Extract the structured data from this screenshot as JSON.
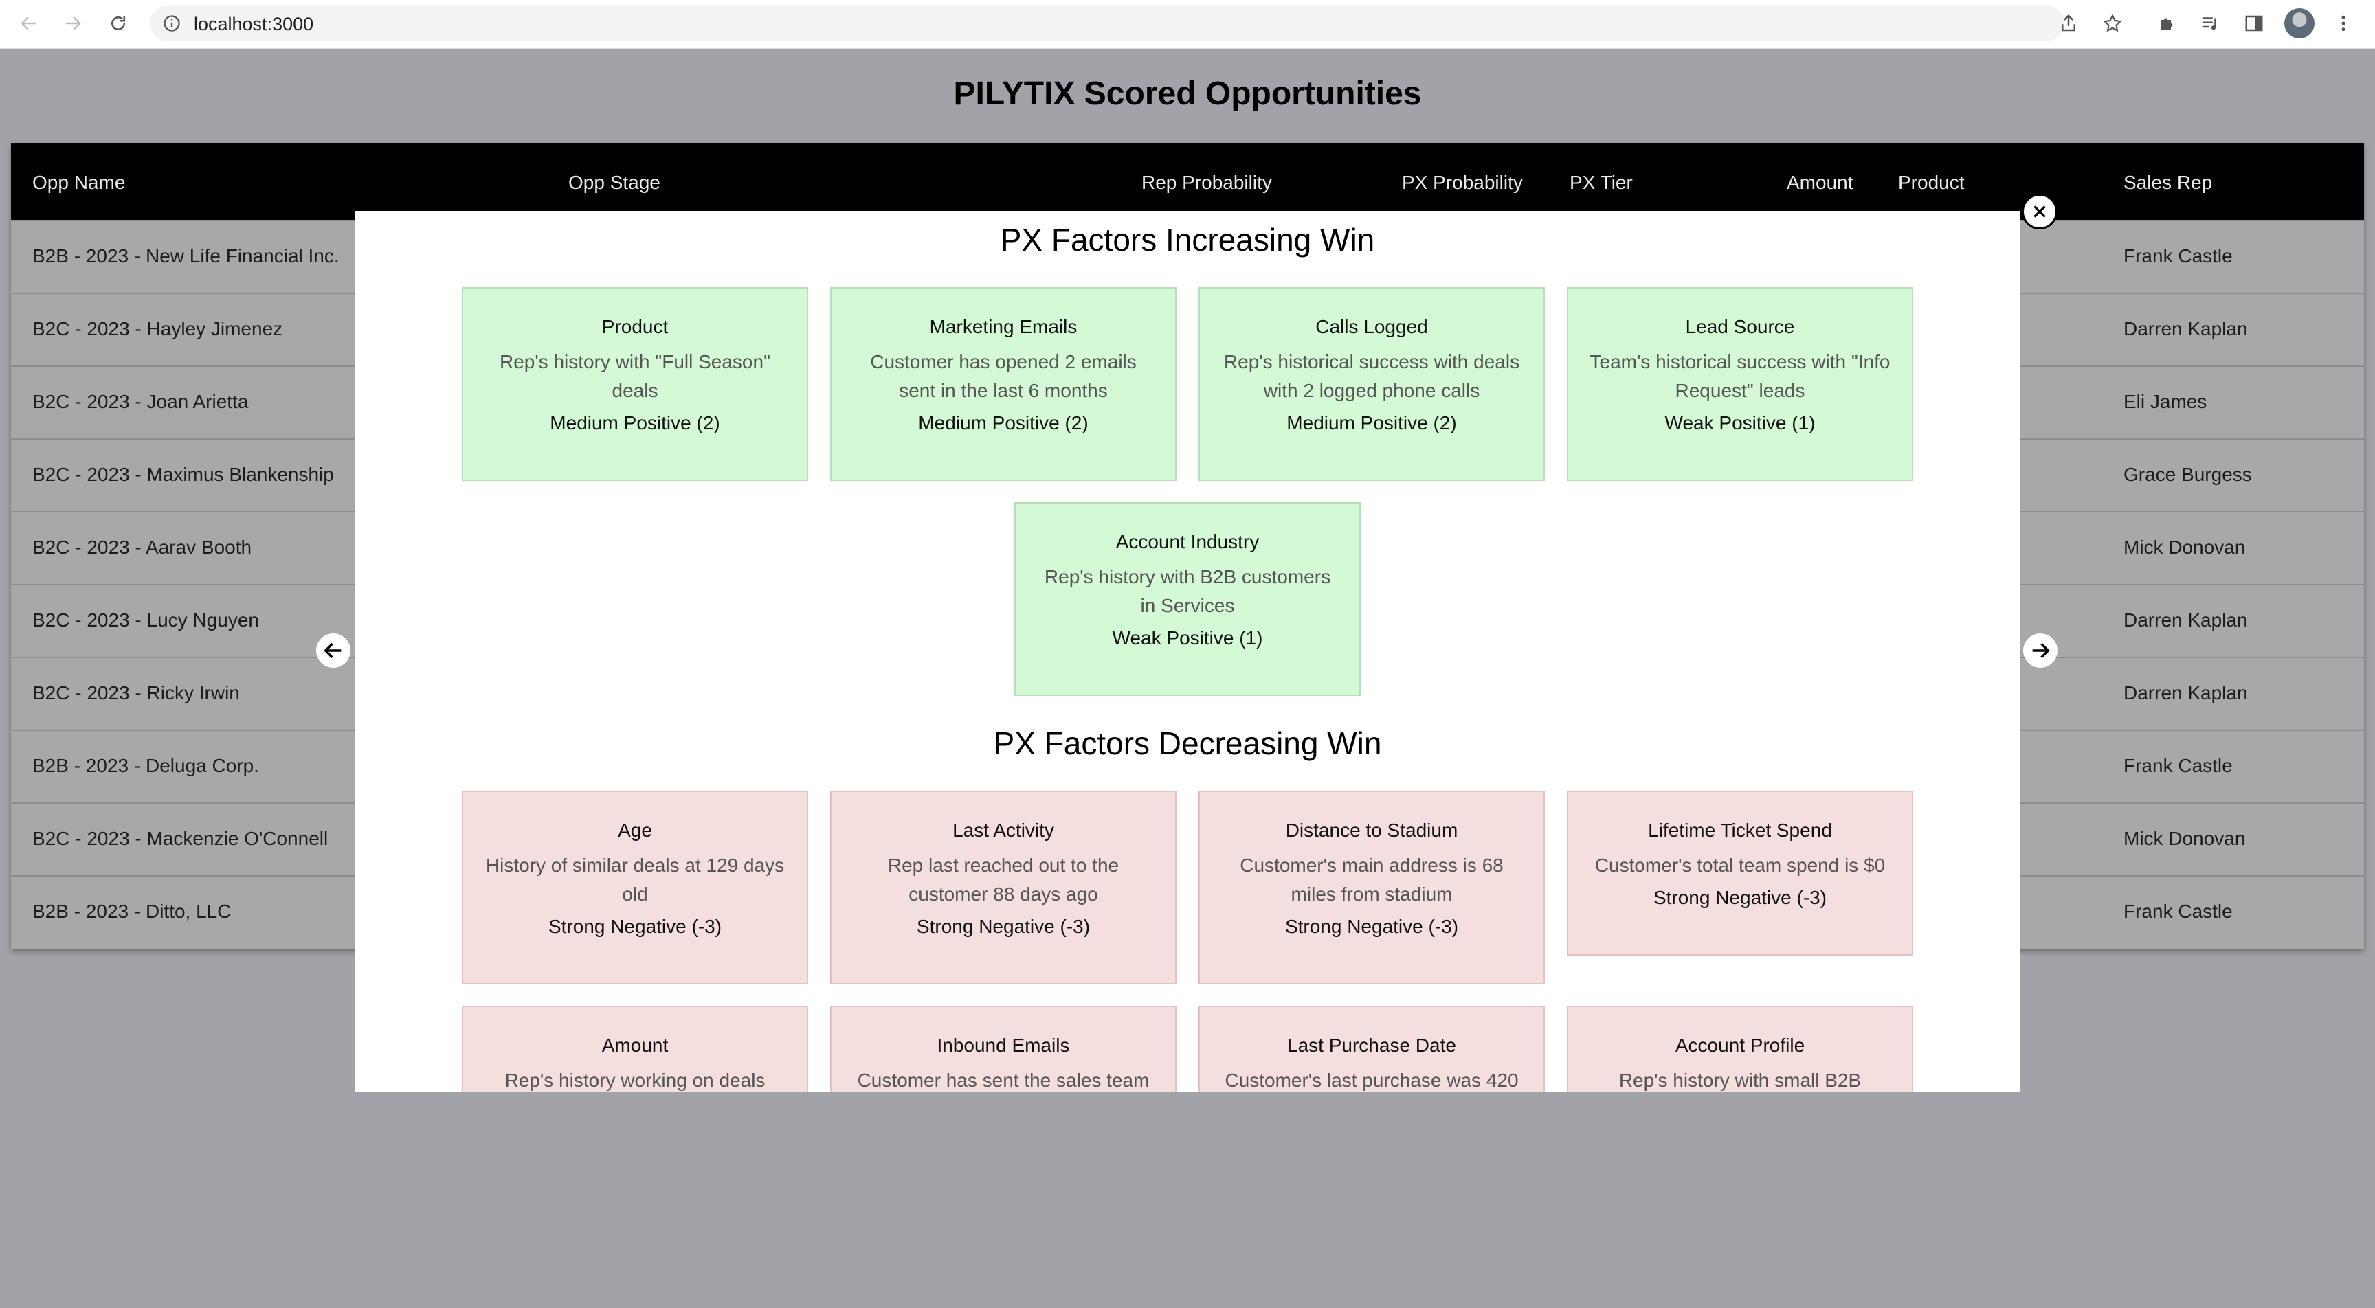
{
  "browser": {
    "url": "localhost:3000"
  },
  "app": {
    "title": "PILYTIX Scored Opportunities"
  },
  "table": {
    "headers": [
      "Opp Name",
      "Opp Stage",
      "Rep Probability",
      "PX Probability",
      "PX Tier",
      "Amount",
      "Product",
      "Sales Rep"
    ],
    "rows": [
      {
        "opp_name": "B2B - 2023 - New Life Financial Inc.",
        "sales_rep": "Frank Castle"
      },
      {
        "opp_name": "B2C - 2023 - Hayley Jimenez",
        "sales_rep": "Darren Kaplan"
      },
      {
        "opp_name": "B2C - 2023 - Joan Arietta",
        "sales_rep": "Eli James"
      },
      {
        "opp_name": "B2C - 2023 - Maximus Blankenship",
        "sales_rep": "Grace Burgess"
      },
      {
        "opp_name": "B2C - 2023 - Aarav Booth",
        "sales_rep": "Mick Donovan"
      },
      {
        "opp_name": "B2C - 2023 - Lucy Nguyen",
        "sales_rep": "Darren Kaplan"
      },
      {
        "opp_name": "B2C - 2023 - Ricky Irwin",
        "sales_rep": "Darren Kaplan"
      },
      {
        "opp_name": "B2B - 2023 - Deluga Corp.",
        "sales_rep": "Frank Castle"
      },
      {
        "opp_name": "B2C - 2023 - Mackenzie O'Connell",
        "sales_rep": "Mick Donovan"
      },
      {
        "opp_name": "B2B - 2023 - Ditto, LLC",
        "sales_rep": "Frank Castle"
      }
    ]
  },
  "modal": {
    "increasing_title": "PX Factors Increasing Win",
    "decreasing_title": "PX Factors Decreasing Win",
    "increasing": [
      {
        "name": "Product",
        "description": "Rep's history with \"Full Season\" deals",
        "score": "Medium Positive (2)"
      },
      {
        "name": "Marketing Emails",
        "description": "Customer has opened 2 emails sent in the last 6 months",
        "score": "Medium Positive (2)"
      },
      {
        "name": "Calls Logged",
        "description": "Rep's historical success with deals with 2 logged phone calls",
        "score": "Medium Positive (2)"
      },
      {
        "name": "Lead Source",
        "description": "Team's historical success with \"Info Request\" leads",
        "score": "Weak Positive (1)"
      },
      {
        "name": "Account Industry",
        "description": "Rep's history with B2B customers in Services",
        "score": "Weak Positive (1)"
      }
    ],
    "decreasing": [
      {
        "name": "Age",
        "description": "History of similar deals at 129 days old",
        "score": "Strong Negative (-3)"
      },
      {
        "name": "Last Activity",
        "description": "Rep last reached out to the customer 88 days ago",
        "score": "Strong Negative (-3)"
      },
      {
        "name": "Distance to Stadium",
        "description": "Customer's main address is 68 miles from stadium",
        "score": "Strong Negative (-3)"
      },
      {
        "name": "Lifetime Ticket Spend",
        "description": "Customer's total team spend is $0",
        "score": "Strong Negative (-3)"
      },
      {
        "name": "Amount",
        "description": "Rep's history working on deals",
        "score": ""
      },
      {
        "name": "Inbound Emails",
        "description": "Customer has sent the sales team",
        "score": ""
      },
      {
        "name": "Last Purchase Date",
        "description": "Customer's last purchase was 420",
        "score": ""
      },
      {
        "name": "Account Profile",
        "description": "Rep's history with small B2B",
        "score": ""
      }
    ]
  },
  "colors": {
    "positive_card": "#d4f9d5",
    "negative_card": "#f5dede",
    "overlay": "#a2a3a8",
    "table_header": "#000000"
  }
}
